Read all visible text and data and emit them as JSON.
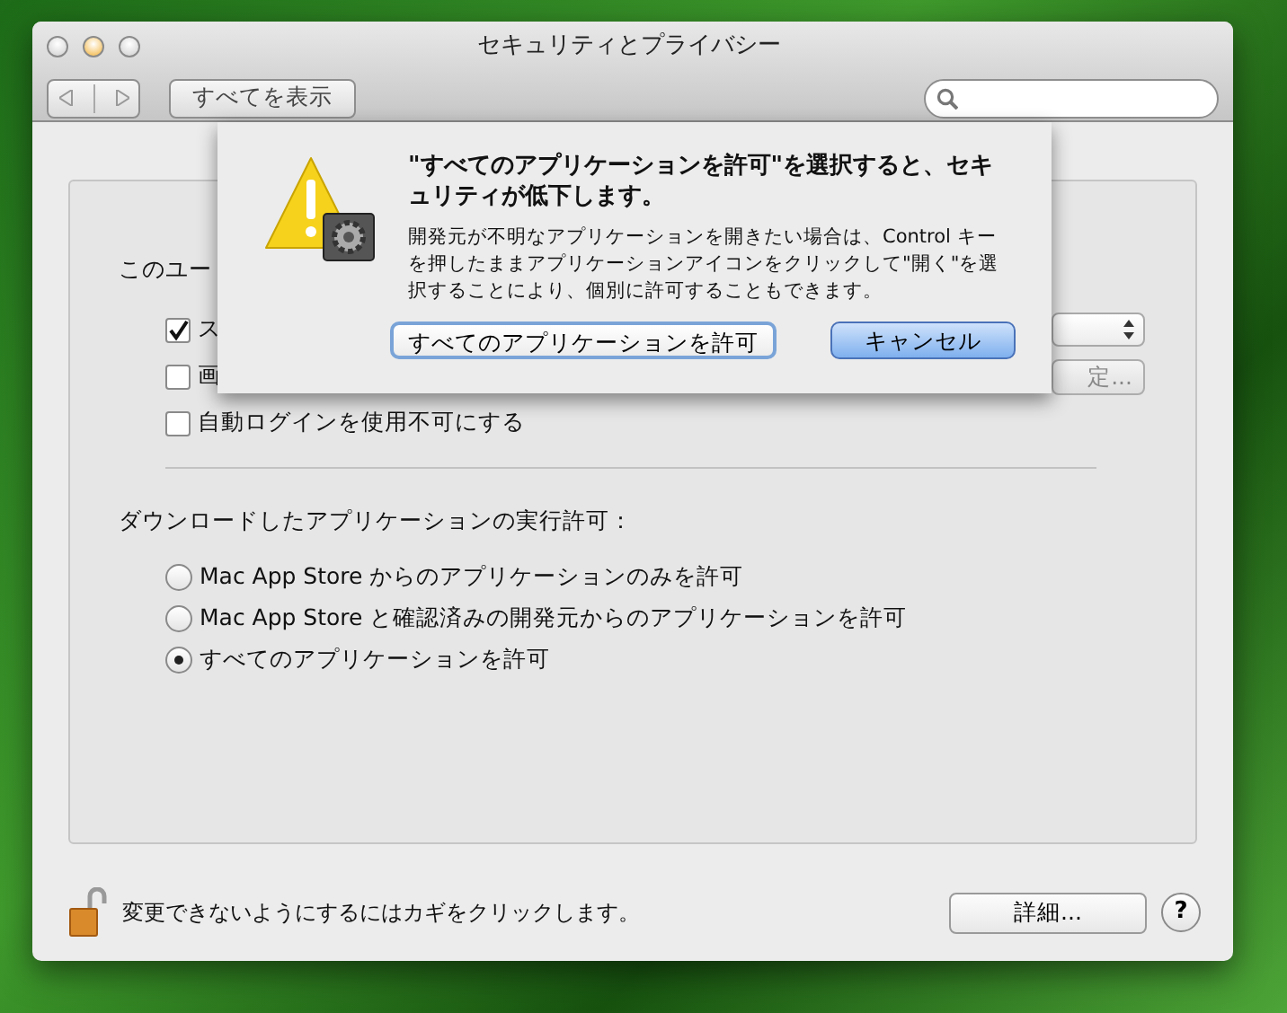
{
  "window": {
    "title": "セキュリティとプライバシー"
  },
  "toolbar": {
    "show_all": "すべてを表示"
  },
  "panel": {
    "intro_partial": "このユー",
    "options": [
      {
        "label": "ス",
        "checked": true
      },
      {
        "label": "画",
        "checked": false
      },
      {
        "label": "自動ログインを使用不可にする",
        "checked": false
      }
    ],
    "message_button_partial": "定...",
    "section_title": "ダウンロードしたアプリケーションの実行許可：",
    "radios": [
      {
        "label": "Mac App Store からのアプリケーションのみを許可",
        "selected": false
      },
      {
        "label": "Mac App Store と確認済みの開発元からのアプリケーションを許可",
        "selected": false
      },
      {
        "label": "すべてのアプリケーションを許可",
        "selected": true
      }
    ]
  },
  "sheet": {
    "title": "\"すべてのアプリケーションを許可\"を選択すると、セキュリティが低下します。",
    "message": "開発元が不明なアプリケーションを開きたい場合は、Control キーを押したままアプリケーションアイコンをクリックして\"開く\"を選択することにより、個別に許可することもできます。",
    "buttons": [
      {
        "label": "すべてのアプリケーションを許可",
        "default": false
      },
      {
        "label": "キャンセル",
        "default": true
      }
    ]
  },
  "footer": {
    "lock_text": "変更できないようにするにはカギをクリックします。",
    "details_button": "詳細...",
    "help": "?"
  }
}
